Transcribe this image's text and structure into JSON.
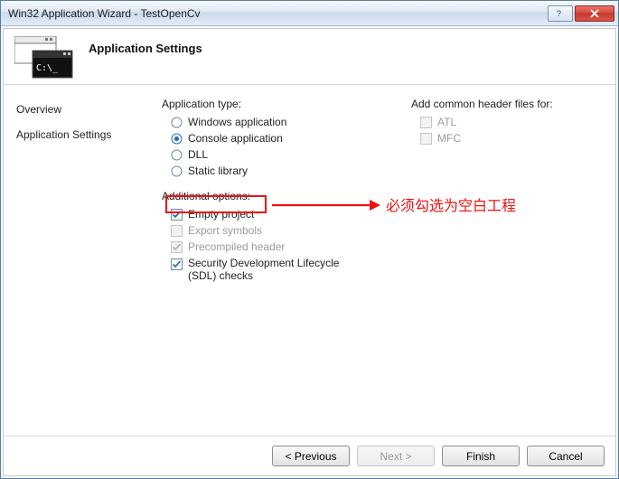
{
  "window": {
    "title": "Win32 Application Wizard - TestOpenCv"
  },
  "header": {
    "title": "Application Settings"
  },
  "sidebar": {
    "items": [
      {
        "label": "Overview"
      },
      {
        "label": "Application Settings"
      }
    ]
  },
  "apptype": {
    "label": "Application type:",
    "options": [
      {
        "label": "Windows application",
        "checked": false
      },
      {
        "label": "Console application",
        "checked": true
      },
      {
        "label": "DLL",
        "checked": false
      },
      {
        "label": "Static library",
        "checked": false
      }
    ]
  },
  "additional": {
    "label": "Additional options:",
    "options": [
      {
        "label": "Empty project",
        "checked": true,
        "enabled": true
      },
      {
        "label": "Export symbols",
        "checked": false,
        "enabled": false
      },
      {
        "label": "Precompiled header",
        "checked": true,
        "enabled": false
      },
      {
        "label": "Security Development Lifecycle (SDL) checks",
        "checked": true,
        "enabled": true
      }
    ]
  },
  "headers": {
    "label": "Add common header files for:",
    "options": [
      {
        "label": "ATL",
        "checked": false,
        "enabled": false
      },
      {
        "label": "MFC",
        "checked": false,
        "enabled": false
      }
    ]
  },
  "buttons": {
    "previous": "< Previous",
    "next": "Next >",
    "finish": "Finish",
    "cancel": "Cancel"
  },
  "annotation": {
    "text": "必须勾选为空白工程",
    "colors": {
      "annotation": "#e11"
    }
  }
}
